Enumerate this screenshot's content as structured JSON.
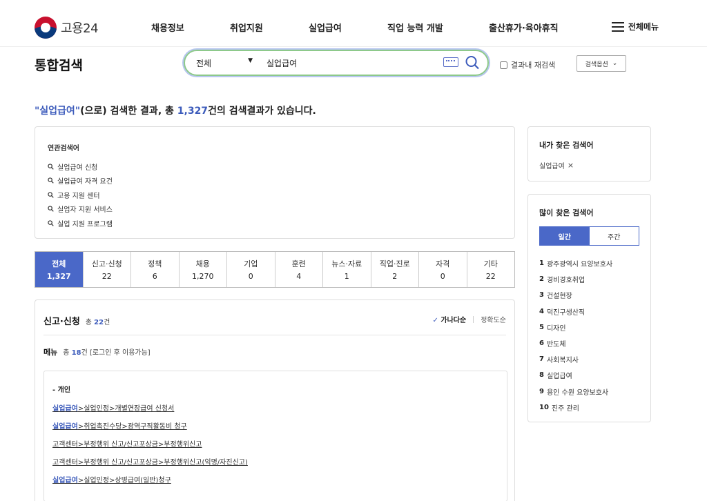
{
  "header": {
    "logo_text": "고용24",
    "nav": [
      "채용정보",
      "취업지원",
      "실업급여",
      "직업 능력 개발",
      "출산휴가·육아휴직"
    ],
    "all_menu": "전체메뉴"
  },
  "search": {
    "page_title": "통합검색",
    "scope": "전체",
    "query": "실업급여",
    "recheck_label": "결과내 재검색",
    "options_label": "검색옵션"
  },
  "summary": {
    "keyword": "\"실업급여\"",
    "text1": "(으로) 검색한 결과, 총 ",
    "count": "1,327",
    "text2": "건의 검색결과가 있습니다."
  },
  "related": {
    "title": "연관검색어",
    "items": [
      "실업급여 신청",
      "실업급여 자격 요건",
      "고용 지원 센터",
      "실업자 지원 서비스",
      "실업 지원 프로그램"
    ]
  },
  "tabs": [
    {
      "label": "전체",
      "count": "1,327"
    },
    {
      "label": "신고·신청",
      "count": "22"
    },
    {
      "label": "정책",
      "count": "6"
    },
    {
      "label": "채용",
      "count": "1,270"
    },
    {
      "label": "기업",
      "count": "0"
    },
    {
      "label": "훈련",
      "count": "4"
    },
    {
      "label": "뉴스·자료",
      "count": "1"
    },
    {
      "label": "직업·진로",
      "count": "2"
    },
    {
      "label": "자격",
      "count": "0"
    },
    {
      "label": "기타",
      "count": "22"
    }
  ],
  "results": {
    "title": "신고·신청",
    "total_prefix": "총 ",
    "total_count": "22",
    "total_suffix": "건",
    "sort_active": "가나다순",
    "sort_other": "정확도순",
    "menu_title": "메뉴",
    "menu_prefix": "총 ",
    "menu_count": "18",
    "menu_suffix": "건 [로그인 후 이용가능]",
    "group": "- 개인",
    "links": [
      {
        "kw": "실업급여",
        "rest": ">실업인정>개별연장급여 신청서"
      },
      {
        "kw": "실업급여",
        "rest": ">취업촉진수당>광역구직활동비 청구"
      },
      {
        "kw": "",
        "rest": "고객센터>부정행위 신고/신고포상금>부정행위신고"
      },
      {
        "kw": "",
        "rest": "고객센터>부정행위 신고/신고포상금>부정행위신고(익명/자진신고)"
      },
      {
        "kw": "실업급여",
        "rest": ">실업인정>상병급여(일반)청구"
      }
    ]
  },
  "my_search": {
    "title": "내가 찾은 검색어",
    "item": "실업급여",
    "remove": "×"
  },
  "popular": {
    "title": "많이 찾은 검색어",
    "tab_daily": "일간",
    "tab_weekly": "주간",
    "items": [
      "광주광역시 요양보호사",
      "경비경호취업",
      "건설현장",
      "덕진구생산직",
      "디자인",
      "반도체",
      "사회복지사",
      "실업급여",
      "용인 수원 요양보호사",
      "진주 관리"
    ]
  },
  "colors": {
    "accent": "#4a68c8",
    "highlight": "#3c5bbb",
    "search_border": "#8dc98a"
  }
}
